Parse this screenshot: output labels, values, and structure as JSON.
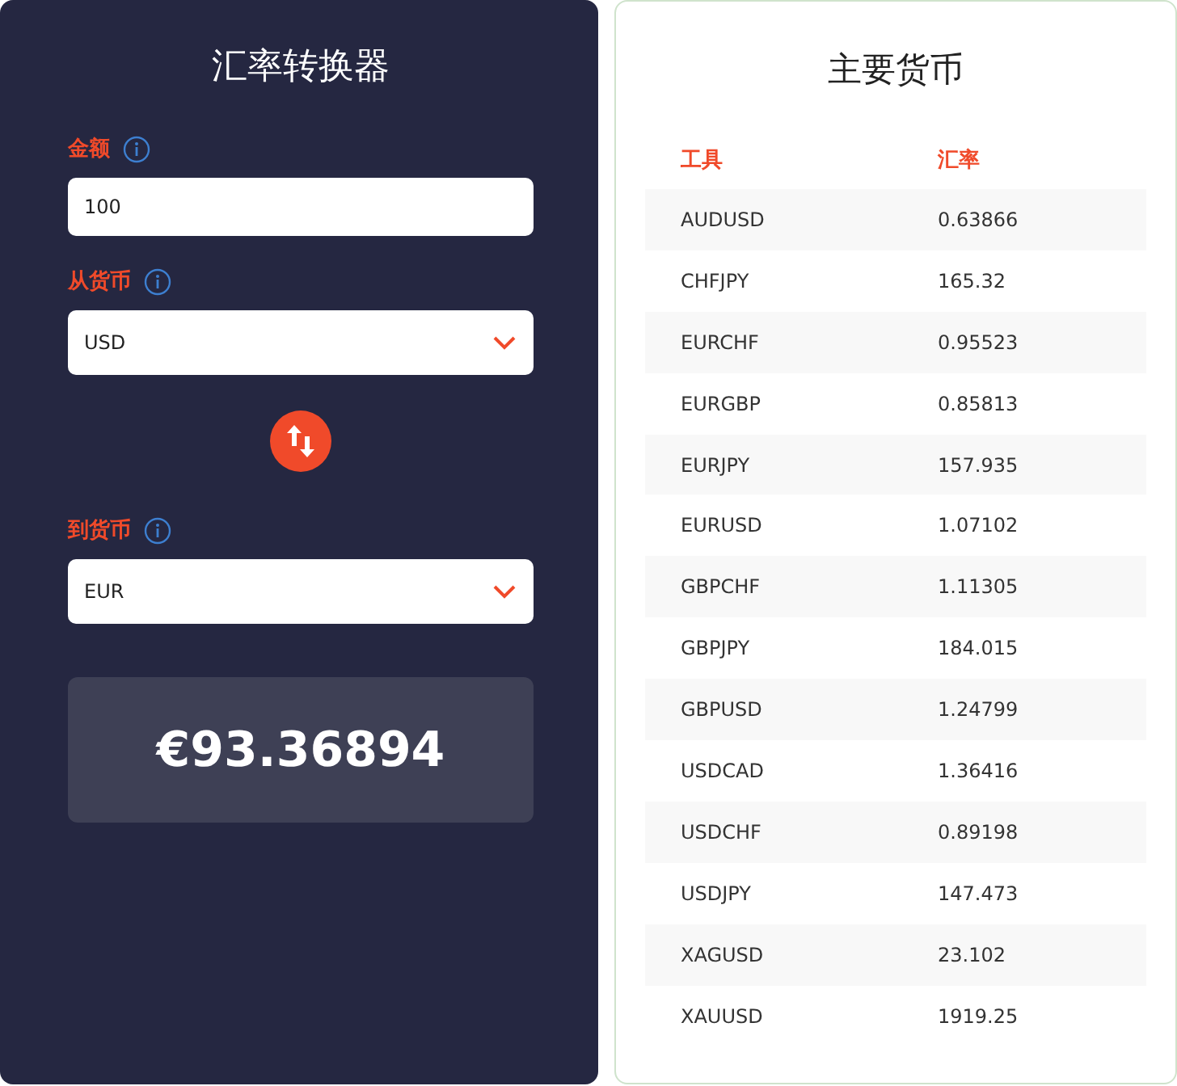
{
  "converter": {
    "title": "汇率转换器",
    "amount": {
      "label": "金额",
      "value": "100"
    },
    "from": {
      "label": "从货币",
      "value": "USD"
    },
    "to": {
      "label": "到货币",
      "value": "EUR"
    },
    "result": "€93.36894"
  },
  "majors": {
    "title": "主要货币",
    "columns": [
      "工具",
      "汇率"
    ],
    "rows": [
      {
        "instrument": "AUDUSD",
        "rate": "0.63866"
      },
      {
        "instrument": "CHFJPY",
        "rate": "165.32"
      },
      {
        "instrument": "EURCHF",
        "rate": "0.95523"
      },
      {
        "instrument": "EURGBP",
        "rate": "0.85813"
      },
      {
        "instrument": "EURJPY",
        "rate": "157.935"
      },
      {
        "instrument": "EURUSD",
        "rate": "1.07102"
      },
      {
        "instrument": "GBPCHF",
        "rate": "1.11305"
      },
      {
        "instrument": "GBPJPY",
        "rate": "184.015"
      },
      {
        "instrument": "GBPUSD",
        "rate": "1.24799"
      },
      {
        "instrument": "USDCAD",
        "rate": "1.36416"
      },
      {
        "instrument": "USDCHF",
        "rate": "0.89198"
      },
      {
        "instrument": "USDJPY",
        "rate": "147.473"
      },
      {
        "instrument": "XAGUSD",
        "rate": "23.102"
      },
      {
        "instrument": "XAUUSD",
        "rate": "1919.25"
      }
    ]
  }
}
